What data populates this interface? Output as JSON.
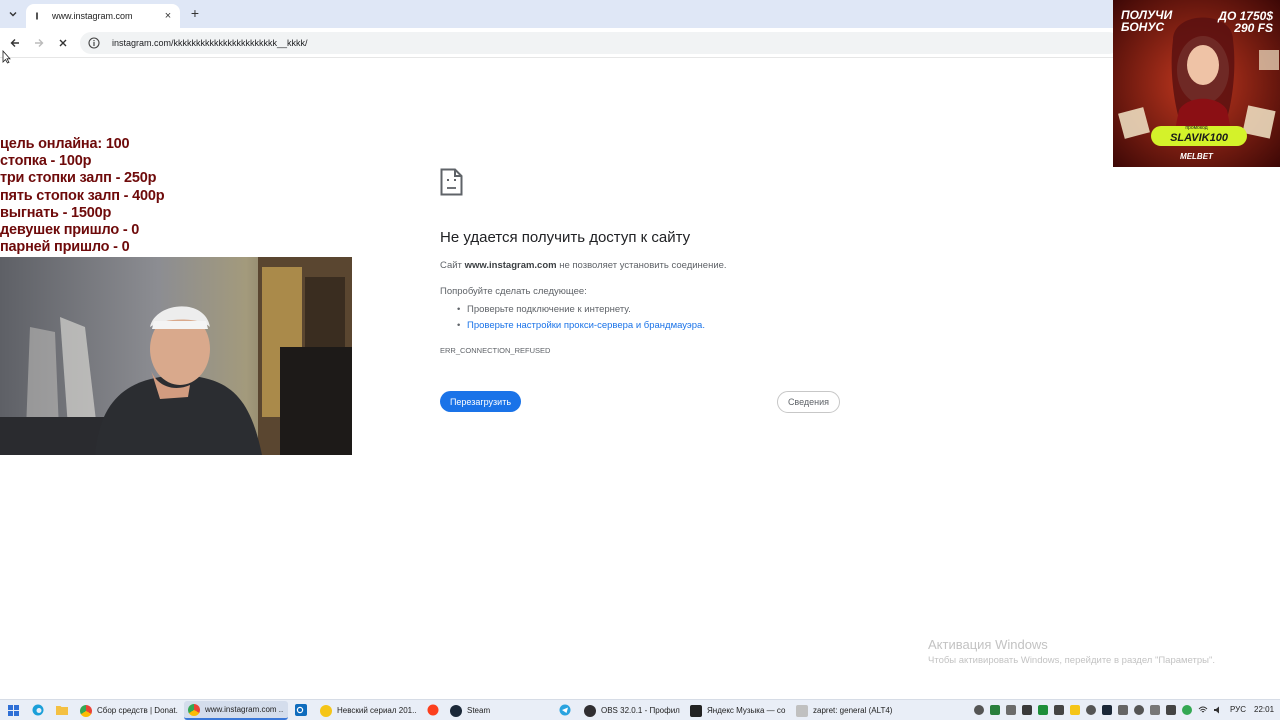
{
  "browser": {
    "tab": {
      "title": "www.instagram.com",
      "close": "×"
    },
    "new_tab": "+",
    "address": {
      "url": "instagram.com/kkkkkkkkkkkkkkkkkkkkkkk__kkkk/"
    }
  },
  "overlay": {
    "lines": [
      "цель онлайна: 100",
      "стопка - 100р",
      "три стопки залп - 250р",
      "пять стопок  залп - 400р",
      "выгнать - 1500р",
      "девушек пришло - 0",
      "парней пришло - 0"
    ]
  },
  "error_page": {
    "title": "Не удается получить доступ к сайту",
    "desc_prefix": "Сайт ",
    "desc_site": "www.instagram.com",
    "desc_suffix": " не позволяет установить соединение.",
    "try_label": "Попробуйте сделать следующее:",
    "suggestions": [
      "Проверьте подключение к интернету.",
      "Проверьте настройки прокси-сервера и брандмауэра."
    ],
    "error_code": "ERR_CONNECTION_REFUSED",
    "reload_button": "Перезагрузить",
    "details_button": "Сведения"
  },
  "ad": {
    "line1a": "ПОЛУЧИ",
    "line1b": "БОНУС",
    "line2a": "ДО 1750$",
    "line2b": "290 FS",
    "promo_label": "промокод",
    "promo_code": "SLAVIK100",
    "brand": "MELBET"
  },
  "windows_activation": {
    "title": "Активация Windows",
    "subtitle": "Чтобы активировать Windows, перейдите в раздел \"Параметры\"."
  },
  "taskbar": {
    "apps": [
      {
        "label": "Сбор средств | Donat...",
        "color": "#ea4335"
      },
      {
        "label": "www.instagram.com ...",
        "color": "#ea4335"
      },
      {
        "label": "Невский сериал 201...",
        "color": "#f5c518"
      },
      {
        "label": "Steam",
        "color": "#1b2838"
      },
      {
        "label": "OBS 32.0.1 - Профил...",
        "color": "#302e31"
      },
      {
        "label": "Яндекс Музыка — со...",
        "color": "#222222"
      },
      {
        "label": "zapret: general (ALT4)",
        "color": "#c0c0c0"
      }
    ],
    "lang": "РУС",
    "time": "22:01"
  }
}
